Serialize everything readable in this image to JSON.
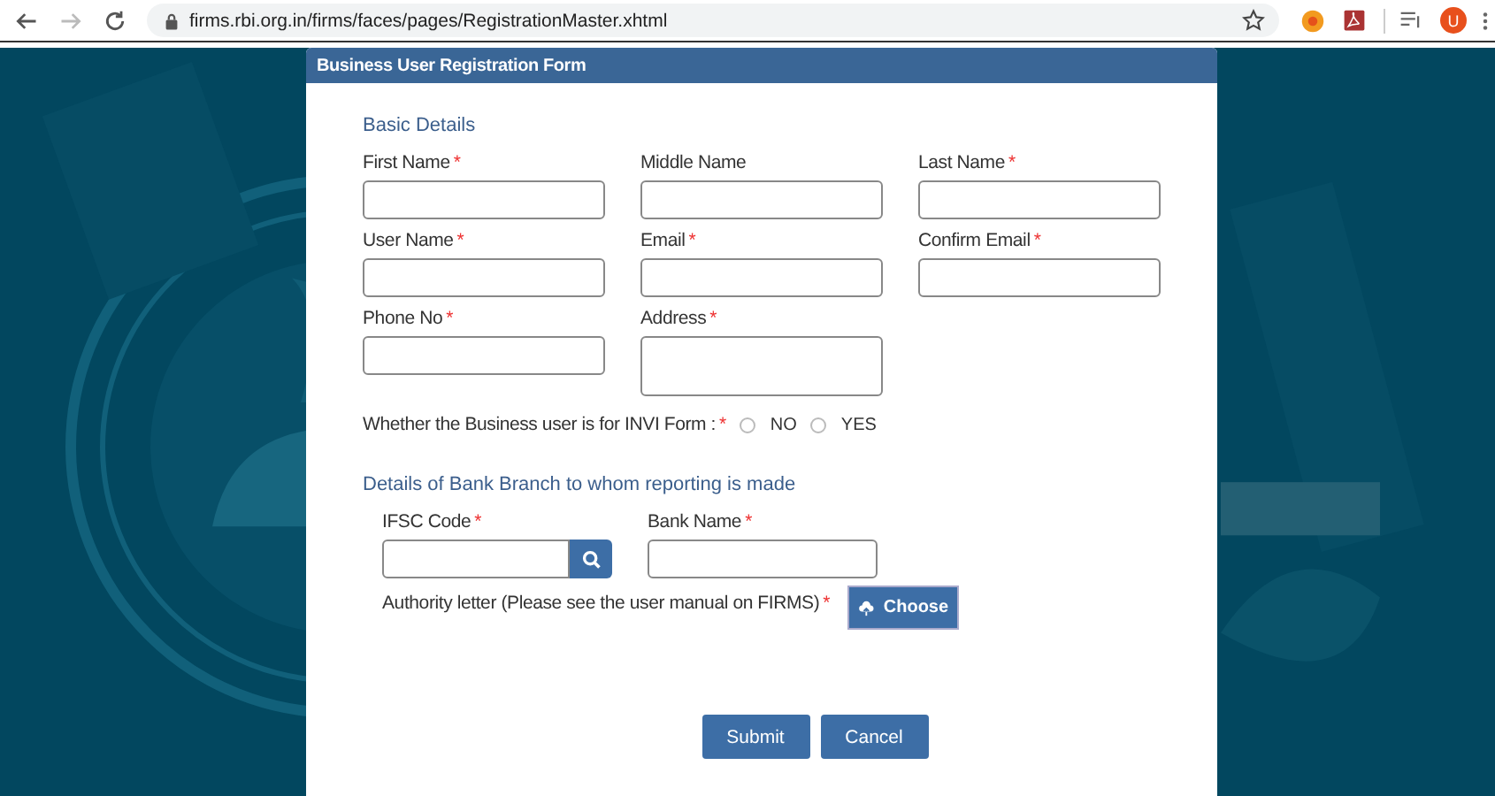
{
  "browser": {
    "url": "firms.rbi.org.in/firms/faces/pages/RegistrationMaster.xhtml",
    "back_disabled": false,
    "forward_disabled": true,
    "avatar_initial": "U"
  },
  "form": {
    "title": "Business User Registration Form",
    "required_mark": "*",
    "basic_heading": "Basic Details",
    "basic_fields": [
      {
        "label": "First Name",
        "required": true,
        "kind": "text"
      },
      {
        "label": "Middle Name",
        "required": false,
        "kind": "text"
      },
      {
        "label": "Last Name",
        "required": true,
        "kind": "text"
      },
      {
        "label": "User Name",
        "required": true,
        "kind": "text"
      },
      {
        "label": "Email",
        "required": true,
        "kind": "text"
      },
      {
        "label": "Confirm Email",
        "required": true,
        "kind": "text"
      },
      {
        "label": "Phone No",
        "required": true,
        "kind": "text"
      },
      {
        "label": "Address",
        "required": true,
        "kind": "textarea"
      }
    ],
    "invi_question": {
      "label": "Whether the Business user is for INVI Form :",
      "required": true,
      "options": [
        {
          "label": "NO",
          "selected": false
        },
        {
          "label": "YES",
          "selected": false
        }
      ]
    },
    "bank_heading": "Details of Bank Branch to whom reporting is made",
    "bank_fields": [
      {
        "label": "IFSC Code",
        "required": true,
        "kind": "search"
      },
      {
        "label": "Bank Name",
        "required": true,
        "kind": "text"
      }
    ],
    "authority_letter": {
      "label": "Authority letter (Please see the user manual on FIRMS)",
      "required": true,
      "button": "Choose"
    },
    "buttons": [
      "Submit",
      "Cancel"
    ]
  }
}
